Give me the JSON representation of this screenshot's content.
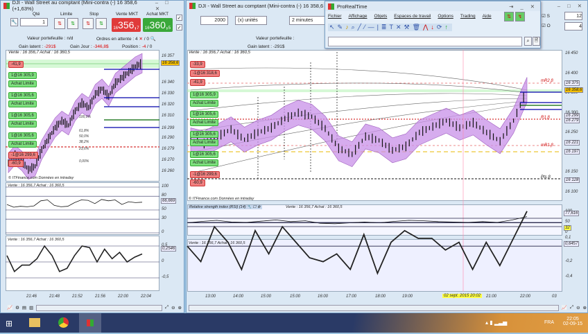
{
  "left_window": {
    "title": "DJI - Wall Street au comptant (Mini-contra (-)   16 358,6 (+1,63%)",
    "qty_label": "Qté",
    "qty_value": "1",
    "limit_label": "Limite",
    "stop_label": "Stop",
    "sell_label": "Vente MKT",
    "sell_small": "16",
    "sell_big": "356,",
    "sell_sup": "7",
    "buy_label": "Achat MKT",
    "buy_small": "16",
    "buy_big": "360,",
    "buy_sup": "5",
    "portfolio": "Valeur portefeuille : n/d",
    "pending": "Ordres en attente : 4",
    "pending2": "/ 0",
    "gain_latent_label": "Gain latent :",
    "gain_latent": "-291$",
    "gain_jour_label": "Gain Jour :",
    "gain_jour": "-346,8$",
    "position_label": "Position :",
    "position": "-4",
    "position2": "/ 0",
    "chart_header": "Vente : 16 356,7  Achat : 16 360,5",
    "orders": [
      {
        "text": "-41,9",
        "type": "red"
      },
      {
        "text": "1@16 305,9",
        "type": "green"
      },
      {
        "text": "Achat Limite",
        "type": "green"
      },
      {
        "text": "1@16 305,6",
        "type": "green"
      },
      {
        "text": "Achat Limite",
        "type": "green"
      },
      {
        "text": "1@16 305,6",
        "type": "green"
      },
      {
        "text": "Achat Limite",
        "type": "green"
      },
      {
        "text": "1@16 305,6",
        "type": "green"
      },
      {
        "text": "Achat Limite",
        "type": "green"
      },
      {
        "text": "-1@16 299,6",
        "type": "red"
      },
      {
        "text": "-60,9",
        "type": "red"
      }
    ],
    "y_ticks": [
      "16 357",
      "16 340",
      "16 330",
      "16 320",
      "16 310",
      "16 299",
      "16 290",
      "16 279",
      "16 270",
      "16 260"
    ],
    "price_tag": "16 358,6",
    "fib": [
      "100,0%",
      "61,8%",
      "50,0%",
      "38,2%",
      "23,6%",
      "0,00%"
    ],
    "copyright": "© ITFinance.com  Données en intraday",
    "ind1_header": "Vente : 16 356,7  Achat : 16 360,5",
    "ind1_ticks": [
      "100",
      "80",
      "50",
      "30",
      "0"
    ],
    "ind1_value": "66,669",
    "ind2_header": "Vente : 16 356,7  Achat : 16 360,5",
    "ind2_ticks": [
      "0,5",
      "0",
      "-0,5"
    ],
    "ind2_value": "0,2546",
    "x_ticks": [
      "21:46",
      "21:48",
      "21:52",
      "21:56",
      "22:00",
      "22:04"
    ],
    "price_path": [
      16268,
      16275,
      16270,
      16262,
      16265,
      16280,
      16290,
      16300,
      16306,
      16302,
      16315,
      16322,
      16318,
      16330,
      16335,
      16328,
      16340,
      16345,
      16350,
      16355,
      16358
    ],
    "ind1_path": [
      62,
      56,
      58,
      57,
      59,
      70,
      72,
      60,
      57,
      58,
      66,
      72,
      71,
      64,
      73,
      70,
      72,
      62,
      68,
      66,
      67
    ],
    "ind2_path": [
      0.2,
      -0.3,
      -0.1,
      -0.1,
      0.1,
      0.5,
      0.2,
      -0.3,
      -0.2,
      0.2,
      0.5,
      0.45,
      0.0,
      0.4,
      0.1,
      0.3,
      0.0,
      0.15,
      0.25
    ]
  },
  "right_window": {
    "title": "DJI - Wall Street au comptant (Mini-contra (-)   16 358,6 (+1,6",
    "qty": "2000",
    "units": "(x) unités",
    "interval": "2 minutes",
    "cb_s": "S",
    "cb_s_val": "12",
    "cb_o": "O",
    "cb_o_val": "4",
    "portfolio": "Valeur portefeuille :",
    "gain_latent": "Gain latent : -291$",
    "chart_header": "Vente : 16 356,7  Achat : 16 360,5",
    "orders": [
      {
        "text": "-33,9",
        "type": "red"
      },
      {
        "text": "-1@16 318,6",
        "type": "red"
      },
      {
        "text": "-41,9",
        "type": "red"
      },
      {
        "text": "1@16 305,9",
        "type": "green"
      },
      {
        "text": "Achat Limite",
        "type": "green"
      },
      {
        "text": "1@16 305,6",
        "type": "green"
      },
      {
        "text": "Achat Limite",
        "type": "green"
      },
      {
        "text": "1@16 305,6",
        "type": "green"
      },
      {
        "text": "Achat Limite",
        "type": "green"
      },
      {
        "text": "1@16 305,6",
        "type": "green"
      },
      {
        "text": "Achat Limite",
        "type": "green"
      },
      {
        "text": "-1@16 299,6",
        "type": "red"
      },
      {
        "text": "-60,9",
        "type": "red"
      }
    ],
    "y_ticks": [
      "16 450",
      "16 400",
      "16 350",
      "16 300",
      "16 250",
      "16 200",
      "16 150",
      "16 100"
    ],
    "tags": [
      "16 375",
      "16 358,6",
      "16 299",
      "16 279",
      "16 221",
      "16 197",
      "16 128"
    ],
    "levels": [
      "mR2 β",
      "R1 β",
      "mR1 β",
      "Pts β"
    ],
    "copyright": "© ITFinance.com  Données en intraday",
    "rsi_header": "Relative strength index (RSI) (14)",
    "rsi_quote": "Vente : 16 356,7  Achat : 16 360,5",
    "rsi_ticks": [
      "100",
      "50",
      "0"
    ],
    "rsi_value": "77,616",
    "rsi_mark": "32",
    "osc_header": "Vente : 16 356,7  Achat : 16 360,5",
    "osc_ticks": [
      "0,2",
      "0,1",
      "0",
      "-0,2",
      "-0,4"
    ],
    "osc_value": "0,6457",
    "x_ticks": [
      "13:00",
      "14:00",
      "15:00",
      "15:00",
      "16:00",
      "17:00",
      "18:00",
      "19:00",
      "21:00",
      "22:00",
      "03"
    ],
    "cursor_date": "02 sept. 2015 20:02",
    "price_path": [
      16230,
      16222,
      16240,
      16258,
      16232,
      16250,
      16262,
      16285,
      16300,
      16290,
      16260,
      16210,
      16195,
      16240,
      16230,
      16205,
      16215,
      16250,
      16265,
      16280,
      16262,
      16275,
      16250,
      16228,
      16280,
      16358
    ],
    "rsi_path": [
      48,
      55,
      60,
      52,
      50,
      56,
      62,
      54,
      58,
      46,
      44,
      48,
      52,
      48,
      55,
      60,
      58,
      54,
      52,
      50,
      54,
      50,
      62,
      78
    ],
    "osc_path": [
      0,
      -0.2,
      0.25,
      0.05,
      -0.3,
      0.2,
      -0.1,
      0.25,
      0.05,
      -0.15,
      -0.2,
      -0.1,
      -0.3,
      0.15,
      -0.35,
      0.05,
      0.2,
      0.1,
      0.1,
      -0.05,
      0.05,
      -0.3,
      0.05,
      -0.25,
      0.1,
      0.45
    ]
  },
  "popup": {
    "title": "ProRealTime",
    "menu": [
      "Fichier",
      "Affichage",
      "Objets",
      "Espaces de travail",
      "Options",
      "Trading",
      "Aide"
    ],
    "search_value": ""
  },
  "taskbar": {
    "lang": "FRA",
    "time": "22:05",
    "date": "02-09-15"
  },
  "colors": {
    "band": "#c890e8",
    "sell": "#e03a3a",
    "buy": "#3aa83a",
    "cursor": "#ffff44"
  }
}
